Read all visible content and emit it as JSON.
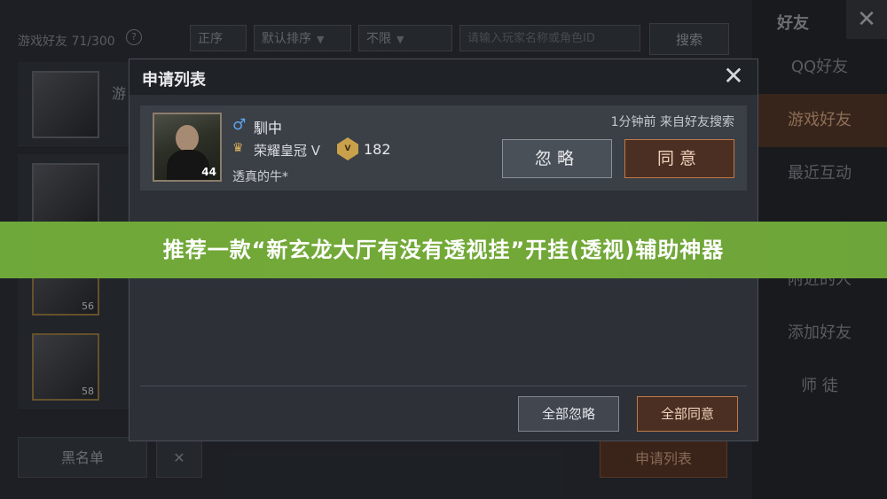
{
  "background": {
    "friend_count": "游戏好友 71/300",
    "help_icon": "?",
    "filters": [
      {
        "label": "正序"
      },
      {
        "label": "默认排序"
      },
      {
        "label": "不限"
      }
    ],
    "search_placeholder": "请输入玩家名称或角色ID",
    "search_button": "搜索",
    "rows": [
      {
        "name": "游",
        "level": ""
      },
      {
        "name": "",
        "level": ""
      },
      {
        "name": "",
        "level": "56"
      },
      {
        "name": "",
        "level": "58"
      }
    ],
    "blacklist_button": "黑名单",
    "apply_list_button": "申请列表"
  },
  "sidebar": {
    "title": "好友",
    "items": [
      {
        "label": "QQ好友",
        "active": false
      },
      {
        "label": "游戏好友",
        "active": true
      },
      {
        "label": "最近互动",
        "active": false
      },
      {
        "label": "附近的人",
        "active": false
      },
      {
        "label": "添加好友",
        "active": false
      },
      {
        "label": "师 徒",
        "active": false
      }
    ]
  },
  "modal": {
    "title": "申请列表",
    "request": {
      "gender_icon": "♂",
      "name": "馴中",
      "rank_name": "荣耀皇冠 V",
      "rank_badge_text": "V",
      "rank_points": "182",
      "level": "44",
      "motto": "透真的牛*",
      "meta": "1分钟前 来自好友搜索",
      "ignore_label": "忽略",
      "agree_label": "同意"
    },
    "ignore_all_label": "全部忽略",
    "agree_all_label": "全部同意"
  },
  "banner": {
    "text": "推荐一款“新玄龙大厅有没有透视挂”开挂(透视)辅助神器"
  }
}
